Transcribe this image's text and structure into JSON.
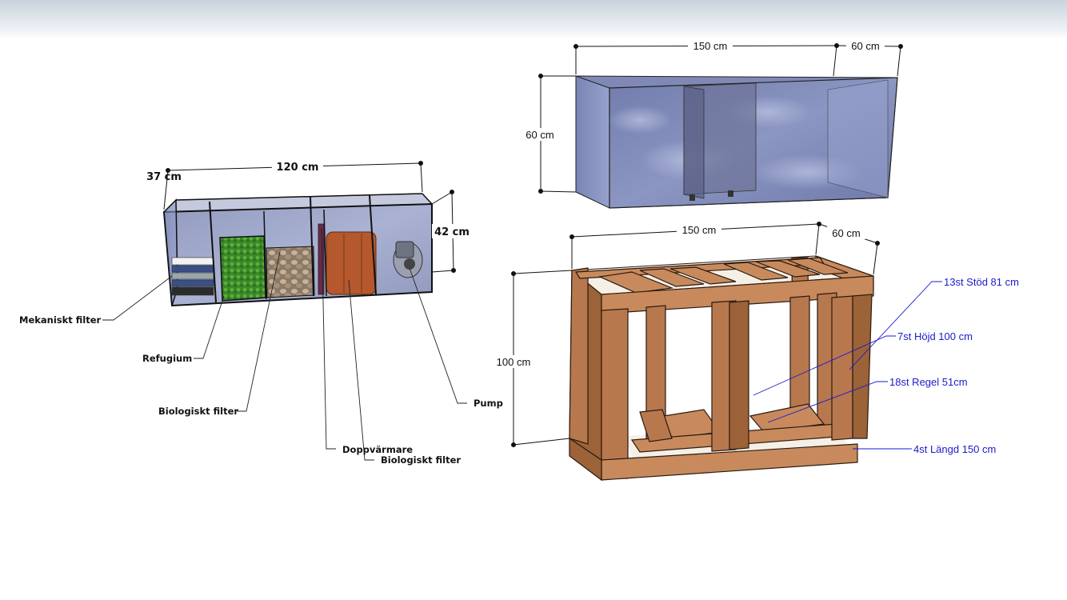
{
  "sump": {
    "dim_width": "120 cm",
    "dim_depth": "37 cm",
    "dim_height": "42 cm",
    "labels": {
      "mech": "Mekaniskt filter",
      "refugium": "Refugium",
      "bio1": "Biologiskt filter",
      "heater": "Doppvärmare",
      "bio2": "Biologiskt filter",
      "pump": "Pump"
    }
  },
  "tank": {
    "dim_width": "150 cm",
    "dim_depth": "60 cm",
    "dim_height": "60 cm"
  },
  "stand": {
    "dim_width": "150 cm",
    "dim_depth": "60 cm",
    "dim_height": "100 cm",
    "parts": {
      "supports": "13st Stöd 81 cm",
      "verticals": "7st Höjd 100 cm",
      "rails": "18st Regel 51cm",
      "lengths": "4st Längd 150 cm"
    }
  },
  "colors": {
    "annotation_blue": "#1a1acc",
    "wood": "#b8784e",
    "glass": "#7d88b5"
  }
}
